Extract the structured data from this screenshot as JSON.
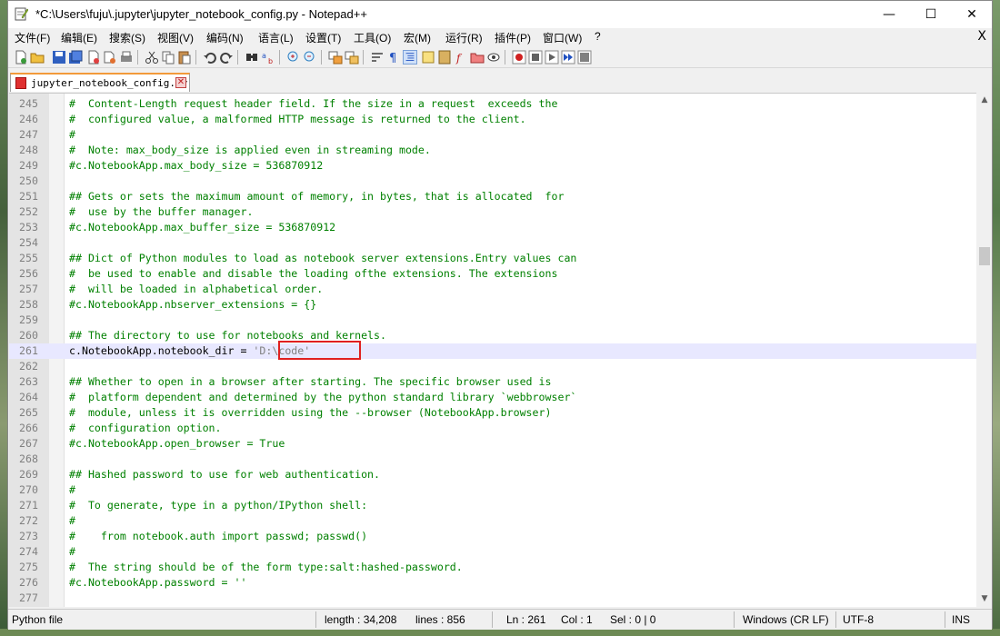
{
  "window": {
    "title": "*C:\\Users\\fuju\\.jupyter\\jupyter_notebook_config.py - Notepad++",
    "minimize": "—",
    "maximize": "☐",
    "close": "✕"
  },
  "menu": {
    "items": [
      "文件(F)",
      "编辑(E)",
      "搜索(S)",
      "视图(V)",
      "编码(N)",
      "语言(L)",
      "设置(T)",
      "工具(O)",
      "宏(M)",
      "运行(R)",
      "插件(P)",
      "窗口(W)",
      "?"
    ],
    "close": "X"
  },
  "toolbar": {
    "icons": [
      "new-file-icon",
      "open-file-icon",
      "save-icon",
      "save-all-icon",
      "close-icon",
      "close-all-icon",
      "print-icon",
      "cut-icon",
      "copy-icon",
      "paste-icon",
      "undo-icon",
      "redo-icon",
      "find-icon",
      "replace-icon",
      "zoom-in-icon",
      "zoom-out-icon",
      "sync-v-icon",
      "sync-h-icon",
      "word-wrap-icon",
      "show-all-chars-icon",
      "indent-guide-icon",
      "udl-icon",
      "doc-map-icon",
      "function-list-icon",
      "folder-as-workspace-icon",
      "monitor-icon",
      "record-macro-icon",
      "stop-record-icon",
      "play-macro-icon",
      "run-macro-multiple-icon",
      "save-macro-icon"
    ]
  },
  "tab": {
    "label": "jupyter_notebook_config.py",
    "close": "✕"
  },
  "editor": {
    "lines": [
      {
        "n": "245",
        "text": "#  Content-Length request header field. If the size in a request  exceeds the"
      },
      {
        "n": "246",
        "text": "#  configured value, a malformed HTTP message is returned to the client."
      },
      {
        "n": "247",
        "text": "#"
      },
      {
        "n": "248",
        "text": "#  Note: max_body_size is applied even in streaming mode."
      },
      {
        "n": "249",
        "text": "#c.NotebookApp.max_body_size = 536870912"
      },
      {
        "n": "250",
        "text": ""
      },
      {
        "n": "251",
        "text": "## Gets or sets the maximum amount of memory, in bytes, that is allocated  for"
      },
      {
        "n": "252",
        "text": "#  use by the buffer manager."
      },
      {
        "n": "253",
        "text": "#c.NotebookApp.max_buffer_size = 536870912"
      },
      {
        "n": "254",
        "text": ""
      },
      {
        "n": "255",
        "text": "## Dict of Python modules to load as notebook server extensions.Entry values can"
      },
      {
        "n": "256",
        "text": "#  be used to enable and disable the loading ofthe extensions. The extensions"
      },
      {
        "n": "257",
        "text": "#  will be loaded in alphabetical order."
      },
      {
        "n": "258",
        "text": "#c.NotebookApp.nbserver_extensions = {}"
      },
      {
        "n": "259",
        "text": ""
      },
      {
        "n": "260",
        "text": "## The directory to use for notebooks and kernels."
      },
      {
        "n": "261",
        "text": "",
        "code": "c.NotebookApp.notebook_dir = ",
        "str": "'D:\\code'"
      },
      {
        "n": "262",
        "text": ""
      },
      {
        "n": "263",
        "text": "## Whether to open in a browser after starting. The specific browser used is"
      },
      {
        "n": "264",
        "text": "#  platform dependent and determined by the python standard library `webbrowser`"
      },
      {
        "n": "265",
        "text": "#  module, unless it is overridden using the --browser (NotebookApp.browser)"
      },
      {
        "n": "266",
        "text": "#  configuration option."
      },
      {
        "n": "267",
        "text": "#c.NotebookApp.open_browser = True"
      },
      {
        "n": "268",
        "text": ""
      },
      {
        "n": "269",
        "text": "## Hashed password to use for web authentication."
      },
      {
        "n": "270",
        "text": "#"
      },
      {
        "n": "271",
        "text": "#  To generate, type in a python/IPython shell:"
      },
      {
        "n": "272",
        "text": "#"
      },
      {
        "n": "273",
        "text": "#    from notebook.auth import passwd; passwd()"
      },
      {
        "n": "274",
        "text": "#"
      },
      {
        "n": "275",
        "text": "#  The string should be of the form type:salt:hashed-password."
      },
      {
        "n": "276",
        "text": "#c.NotebookApp.password = ''"
      },
      {
        "n": "277",
        "text": ""
      }
    ],
    "current_line": "261"
  },
  "status": {
    "file_type": "Python file",
    "length": "length : 34,208",
    "lines": "lines : 856",
    "ln": "Ln : 261",
    "col": "Col : 1",
    "sel": "Sel : 0 | 0",
    "eol": "Windows (CR LF)",
    "encoding": "UTF-8",
    "mode": "INS"
  },
  "colors": {
    "comment": "#008000",
    "identifier": "#000000",
    "string": "#808080",
    "current_line_bg": "#e8e8ff",
    "highlight_box": "#e02020",
    "tab_accent": "#f29a3a"
  }
}
